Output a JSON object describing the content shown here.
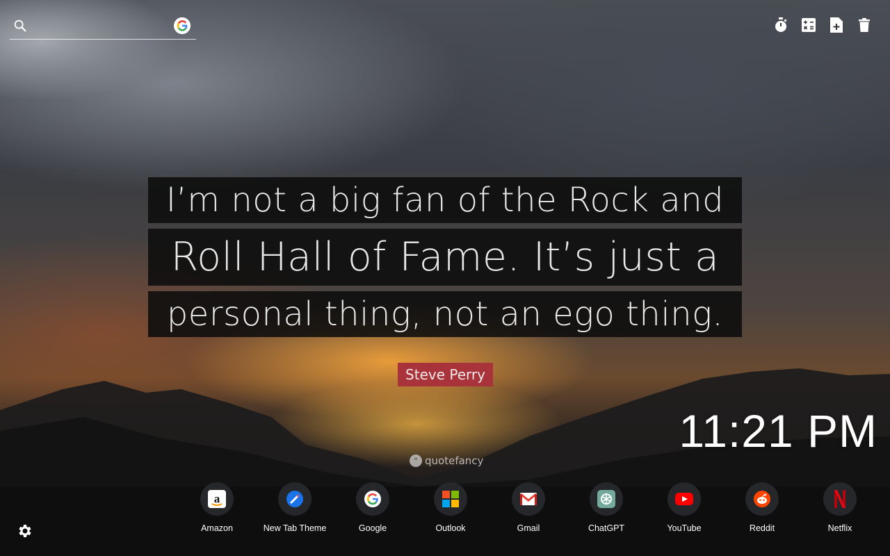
{
  "search": {
    "placeholder": "",
    "value": ""
  },
  "tools": [
    {
      "name": "timer-icon"
    },
    {
      "name": "calculator-icon"
    },
    {
      "name": "add-note-icon"
    },
    {
      "name": "trash-icon"
    }
  ],
  "quote": {
    "lines": [
      "I’m not a big fan of the Rock and",
      "Roll Hall of Fame. It’s just a",
      "personal thing, not an ego thing."
    ],
    "author": "Steve Perry"
  },
  "clock": {
    "time": "11:21 PM"
  },
  "brand": {
    "name": "quotefancy"
  },
  "shortcuts": [
    {
      "label": "Amazon",
      "icon": "amazon-icon"
    },
    {
      "label": "New Tab Theme",
      "icon": "new-tab-theme-icon"
    },
    {
      "label": "Google",
      "icon": "google-icon"
    },
    {
      "label": "Outlook",
      "icon": "outlook-icon"
    },
    {
      "label": "Gmail",
      "icon": "gmail-icon"
    },
    {
      "label": "ChatGPT",
      "icon": "chatgpt-icon"
    },
    {
      "label": "YouTube",
      "icon": "youtube-icon"
    },
    {
      "label": "Reddit",
      "icon": "reddit-icon"
    },
    {
      "label": "Netflix",
      "icon": "netflix-icon"
    }
  ],
  "colors": {
    "author_bg": "#a8333a",
    "quote_bg": "#0c0c0c"
  }
}
